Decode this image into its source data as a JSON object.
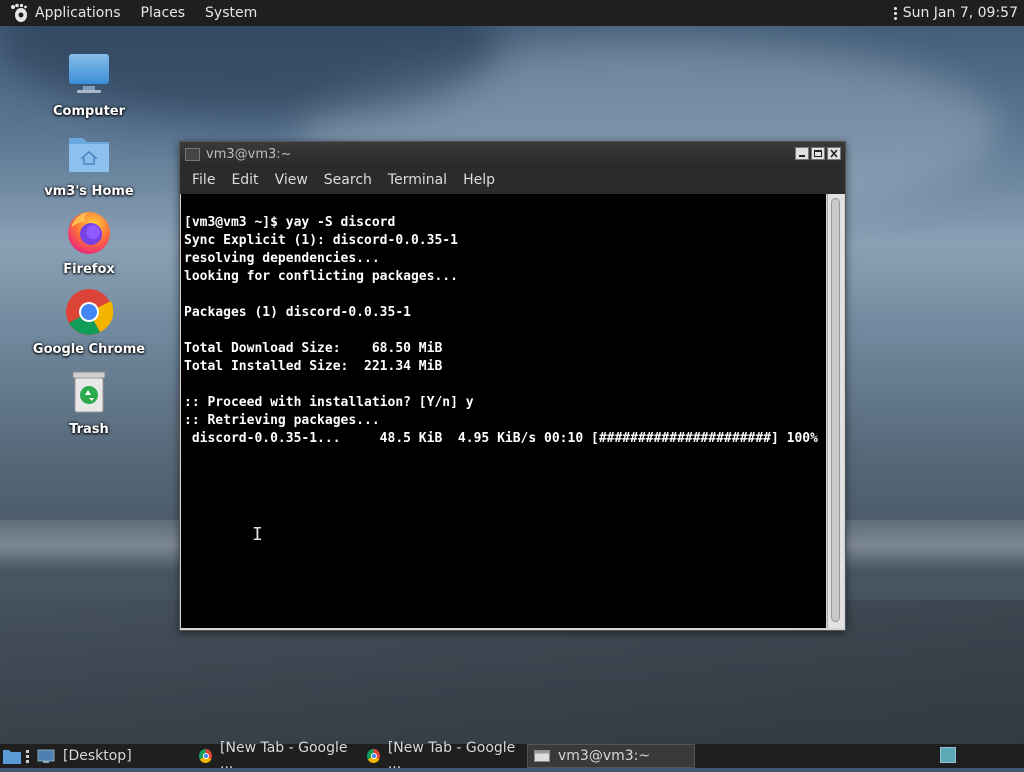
{
  "top_panel": {
    "menus": [
      "Applications",
      "Places",
      "System"
    ],
    "clock": "Sun Jan  7, 09:57"
  },
  "desktop_icons": [
    {
      "label": "Computer",
      "icon": "computer-icon"
    },
    {
      "label": "vm3's Home",
      "icon": "home-folder-icon"
    },
    {
      "label": "Firefox",
      "icon": "firefox-icon"
    },
    {
      "label": "Google Chrome",
      "icon": "chrome-icon"
    },
    {
      "label": "Trash",
      "icon": "trash-icon"
    }
  ],
  "terminal": {
    "title": "vm3@vm3:~",
    "menus": [
      "File",
      "Edit",
      "View",
      "Search",
      "Terminal",
      "Help"
    ],
    "lines": [
      "[vm3@vm3 ~]$ yay -S discord",
      "Sync Explicit (1): discord-0.0.35-1",
      "resolving dependencies...",
      "looking for conflicting packages...",
      "",
      "Packages (1) discord-0.0.35-1",
      "",
      "Total Download Size:    68.50 MiB",
      "Total Installed Size:  221.34 MiB",
      "",
      ":: Proceed with installation? [Y/n] y",
      ":: Retrieving packages...",
      " discord-0.0.35-1...     48.5 KiB  4.95 KiB/s 00:10 [######################] 100%"
    ]
  },
  "taskbar": {
    "items": [
      {
        "label": "[Desktop]",
        "icon": "desktop-icon",
        "active": false
      },
      {
        "label": "[New Tab - Google ...",
        "icon": "chrome-icon",
        "active": false
      },
      {
        "label": "[New Tab - Google ...",
        "icon": "chrome-icon",
        "active": false
      },
      {
        "label": "vm3@vm3:~",
        "icon": "terminal-icon",
        "active": true
      }
    ]
  },
  "colors": {
    "panel": "#1f1f1f",
    "terminal_bg": "#000000",
    "terminal_fg": "#ffffff"
  }
}
